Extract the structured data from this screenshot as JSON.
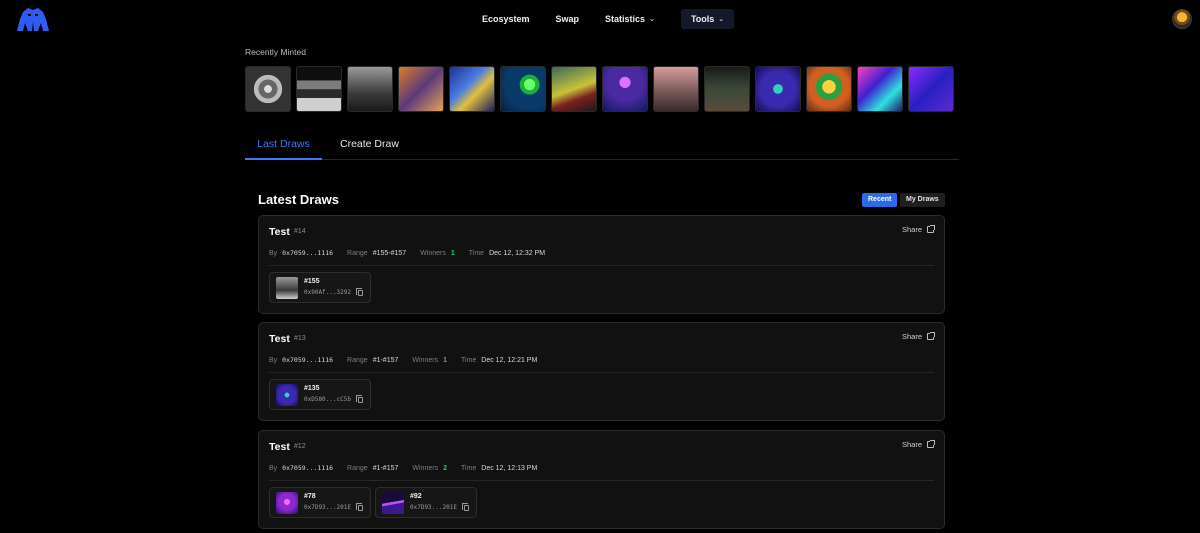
{
  "nav": {
    "logo_icon": "gorilla-logo-icon",
    "links": [
      "Ecosystem",
      "Swap",
      "Statistics",
      "Tools"
    ],
    "avatar_icon": "user-avatar-icon"
  },
  "recently_minted": {
    "label": "Recently Minted"
  },
  "tabs": [
    "Last Draws",
    "Create Draw"
  ],
  "draws_section": {
    "title": "Latest Draws",
    "filters": [
      "Recent",
      "My Draws"
    ]
  },
  "labels": {
    "by": "By",
    "range": "Range",
    "winners": "Winners",
    "time": "Time",
    "share": "Share"
  },
  "draws": [
    {
      "title": "Test",
      "id": "#14",
      "by": "0x7059...1116",
      "range": "#155-#157",
      "winners": "1",
      "time": "Dec 12, 12:32 PM",
      "entries": [
        {
          "num": "#155",
          "addr": "0x90Af...3292"
        }
      ]
    },
    {
      "title": "Test",
      "id": "#13",
      "by": "0x7059...1116",
      "range": "#1-#157",
      "winners": "1",
      "time": "Dec 12, 12:21 PM",
      "entries": [
        {
          "num": "#135",
          "addr": "0xD580...cC5b"
        }
      ]
    },
    {
      "title": "Test",
      "id": "#12",
      "by": "0x7059...1116",
      "range": "#1-#157",
      "winners": "2",
      "time": "Dec 12, 12:13 PM",
      "entries": [
        {
          "num": "#78",
          "addr": "0x7D93...201E"
        },
        {
          "num": "#92",
          "addr": "0x7D93...201E"
        }
      ]
    }
  ],
  "colors": {
    "accent": "#2d6ae8",
    "tab_active": "#3a7bf6",
    "winners_green": "#35c35b"
  }
}
